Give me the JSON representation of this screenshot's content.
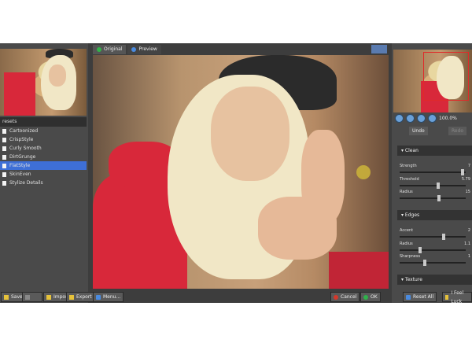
{
  "tabs": [
    {
      "label": "Original"
    },
    {
      "label": "Preview"
    }
  ],
  "presets": {
    "header": "resets",
    "items": [
      {
        "label": "Cartoonized"
      },
      {
        "label": "CrispStyle"
      },
      {
        "label": "Curly Smooth"
      },
      {
        "label": "DirtGrunge"
      },
      {
        "label": "FlatStyle"
      },
      {
        "label": "SkinEven"
      },
      {
        "label": "Stylize Details"
      }
    ]
  },
  "left_buttons": {
    "save": "Save",
    "import": "Import",
    "export": "Export"
  },
  "center_bottom": {
    "menu": "Menu...",
    "cancel": "Cancel",
    "ok": "OK"
  },
  "zoom": {
    "value": "100.0%"
  },
  "right_tools": {
    "undo": "Undo",
    "redo": "Redo"
  },
  "sections": [
    {
      "title": "Clean",
      "sliders": [
        {
          "label": "Strength",
          "value": "7"
        },
        {
          "label": "Threshold",
          "value": "5.79"
        },
        {
          "label": "Radius",
          "value": "15"
        }
      ]
    },
    {
      "title": "Edges",
      "sliders": [
        {
          "label": "Accent",
          "value": "2"
        },
        {
          "label": "Radius",
          "value": "1.1"
        },
        {
          "label": "Sharpness",
          "value": "1"
        }
      ]
    },
    {
      "title": "Texture",
      "sliders": []
    }
  ],
  "right_bottom": {
    "reset": "Reset All",
    "feel": "I Feel Luck"
  },
  "colors": {
    "accent": "#3e6fd6",
    "panel": "#4a4a4a",
    "frame": "#3d3d3d"
  }
}
